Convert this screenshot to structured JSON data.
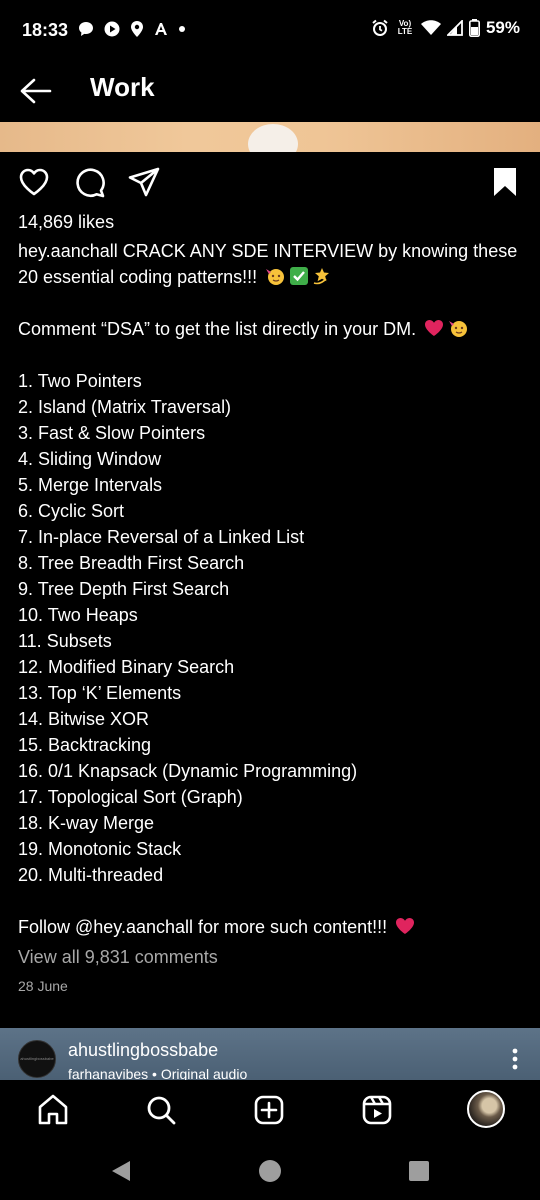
{
  "status_bar": {
    "time": "18:33",
    "network_badge": "Vo) LTE",
    "battery": "59%"
  },
  "header": {
    "title": "Work"
  },
  "post": {
    "likes": "14,869 likes",
    "caption_intro": "hey.aanchall CRACK ANY SDE INTERVIEW by knowing these 20 essential coding patterns!!!",
    "caption_comment_cta": "Comment “DSA” to get the list directly in your DM.",
    "patterns": [
      "1. Two Pointers",
      "2. Island (Matrix Traversal)",
      "3. Fast & Slow Pointers",
      "4. Sliding Window",
      "5. Merge Intervals",
      "6. Cyclic Sort",
      "7. In-place Reversal of a Linked List",
      "8. Tree Breadth First Search",
      "9. Tree Depth First Search",
      "10. Two Heaps",
      "11. Subsets",
      "12. Modified Binary Search",
      "13. Top ‘K’ Elements",
      "14. Bitwise XOR",
      "15. Backtracking",
      "16. 0/1 Knapsack (Dynamic Programming)",
      "17. Topological Sort (Graph)",
      "18. K-way Merge",
      "19. Monotonic Stack",
      "20. Multi-threaded"
    ],
    "caption_follow": "Follow @hey.aanchall for more such content!!!",
    "view_comments": "View all 9,831 comments",
    "date": "28 June"
  },
  "next_post": {
    "username": "ahustlingbossbabe",
    "audio": "farhanavibes • Original audio",
    "avatar_text": "ahustlingbossbabe"
  },
  "icons": {
    "heart": "heart-icon",
    "comment": "comment-icon",
    "share": "send-icon",
    "save": "bookmark-icon",
    "home": "home-icon",
    "search": "search-icon",
    "create": "add-post-icon",
    "reels": "reels-icon",
    "profile": "profile-avatar"
  },
  "colors": {
    "background": "#000000",
    "text": "#ffffff",
    "muted": "#a8a8a8",
    "heart_emoji": "#e0245e",
    "next_post_bg": "#566b80"
  }
}
